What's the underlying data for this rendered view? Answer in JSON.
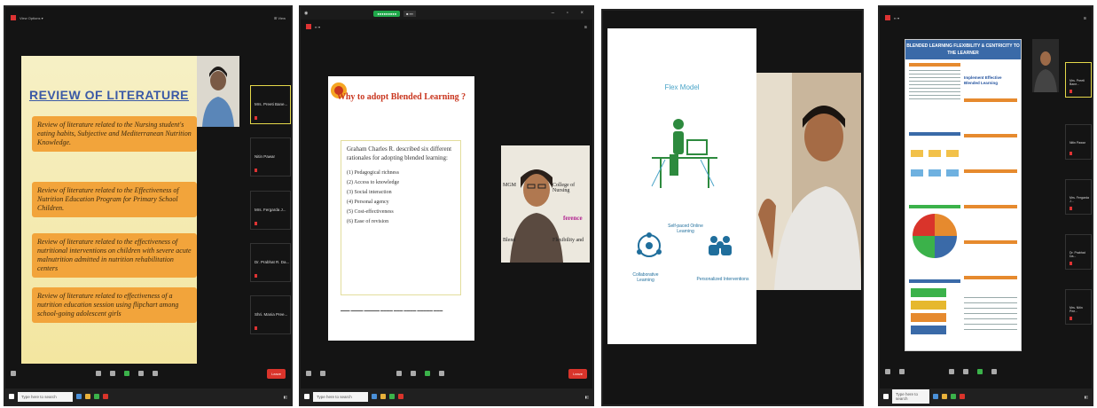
{
  "shot1": {
    "slide_title": "REVIEW OF LITERATURE",
    "boxes": [
      "Review of literature related to the Nursing student's eating habits, Subjective and Mediterranean Nutrition Knowledge.",
      "Review of literature related to the Effectiveness of Nutrition Education Program for Primary School Children.",
      "Review of literature related to the effectiveness of nutritional interventions on children with severe acute malnutrition admitted in nutrition rehabilitation centers",
      "Review of literature related to effectiveness of a nutrition education session using flipchart among school-going adolescent girls"
    ],
    "participants": [
      "Mrs. Preeti Bane...",
      "Nitin Pawar",
      "Mrs. Fergarda J...",
      "Dr. Prabhat R. Da...",
      "Shri. Mania Pree..."
    ],
    "end_label": "Leave",
    "search_placeholder": "Type here to search"
  },
  "shot2": {
    "slide_title": "Why to adopt Blended Learning ?",
    "intro": "Graham Charles R. described six different rationales for adopting blended learning:",
    "items": [
      "(1) Pedagogical richness",
      "(2) Access to knowledge",
      "(3) Social interaction",
      "(4) Personal agency",
      "(5) Cost-effectiveness",
      "(6) Ease of revision"
    ],
    "cam_texts": [
      "College of Nursing",
      "ference",
      "Flexibility and",
      "MGM",
      "Blend"
    ],
    "end_label": "Leave",
    "search_placeholder": "Type here to search"
  },
  "shot3": {
    "slide_title": "Flex Model",
    "labels": [
      "Self-paced Online Learning",
      "Collaborative Learning",
      "Personalized Interventions"
    ]
  },
  "shot4": {
    "poster_title": "BLENDED LEARNING FLEXIBILITY & CENTRICITY TO THE LEARNER",
    "poster_sub": "Implement Effective Blended Learning",
    "participants": [
      "Mrs. Preeti Bane...",
      "Nitin Pawar",
      "Mrs. Fergarda J...",
      "Dr. Prabhat Da...",
      "Mrs. Nitin Pee..."
    ],
    "search_placeholder": "Type here to search"
  }
}
